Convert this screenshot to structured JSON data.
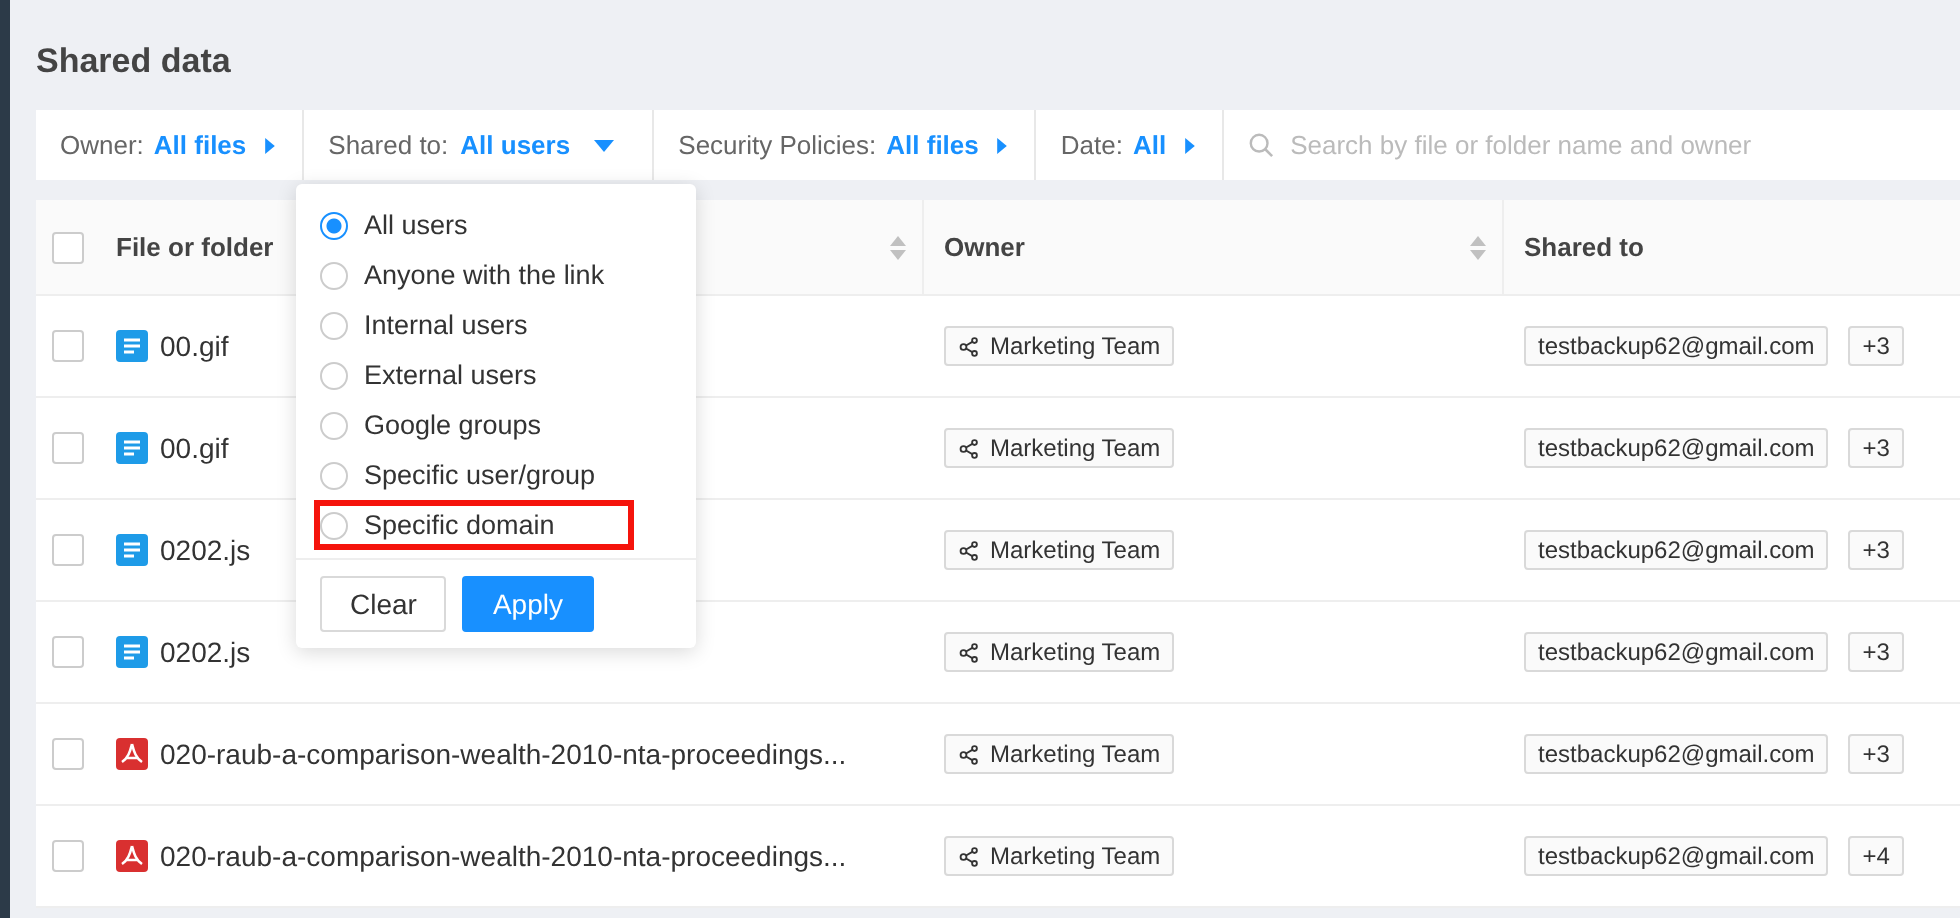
{
  "page_title": "Shared data",
  "filters": [
    {
      "label": "Owner:",
      "value": "All files",
      "expanded": false
    },
    {
      "label": "Shared to:",
      "value": "All users",
      "expanded": true
    },
    {
      "label": "Security Policies:",
      "value": "All files",
      "expanded": false
    },
    {
      "label": "Date:",
      "value": "All",
      "expanded": false
    }
  ],
  "search": {
    "placeholder": "Search by file or folder name and owner"
  },
  "table": {
    "columns": [
      {
        "label": "File or folder",
        "sortable": true
      },
      {
        "label": "Owner",
        "sortable": true
      },
      {
        "label": "Shared to",
        "sortable": false
      }
    ],
    "select_all": {
      "checked": false
    },
    "rows": [
      {
        "checked": false,
        "kind": "doc",
        "name": "00.gif",
        "owner": "Marketing Team",
        "shared_to": "testbackup62@gmail.com",
        "more": "+3"
      },
      {
        "checked": false,
        "kind": "doc",
        "name": "00.gif",
        "owner": "Marketing Team",
        "shared_to": "testbackup62@gmail.com",
        "more": "+3"
      },
      {
        "checked": false,
        "kind": "doc",
        "name": "0202.js",
        "owner": "Marketing Team",
        "shared_to": "testbackup62@gmail.com",
        "more": "+3"
      },
      {
        "checked": false,
        "kind": "doc",
        "name": "0202.js",
        "owner": "Marketing Team",
        "shared_to": "testbackup62@gmail.com",
        "more": "+3"
      },
      {
        "checked": false,
        "kind": "pdf",
        "name": "020-raub-a-comparison-wealth-2010-nta-proceedings...",
        "owner": "Marketing Team",
        "shared_to": "testbackup62@gmail.com",
        "more": "+3"
      },
      {
        "checked": false,
        "kind": "pdf",
        "name": "020-raub-a-comparison-wealth-2010-nta-proceedings...",
        "owner": "Marketing Team",
        "shared_to": "testbackup62@gmail.com",
        "more": "+4"
      }
    ]
  },
  "dropdown": {
    "options": [
      {
        "label": "All users",
        "selected": true,
        "highlighted": false
      },
      {
        "label": "Anyone with the link",
        "selected": false,
        "highlighted": false
      },
      {
        "label": "Internal users",
        "selected": false,
        "highlighted": false
      },
      {
        "label": "External users",
        "selected": false,
        "highlighted": false
      },
      {
        "label": "Google groups",
        "selected": false,
        "highlighted": false
      },
      {
        "label": "Specific user/group",
        "selected": false,
        "highlighted": false
      },
      {
        "label": "Specific domain",
        "selected": false,
        "highlighted": true
      }
    ],
    "buttons": [
      {
        "label": "Clear",
        "kind": "secondary"
      },
      {
        "label": "Apply",
        "kind": "primary"
      }
    ]
  }
}
